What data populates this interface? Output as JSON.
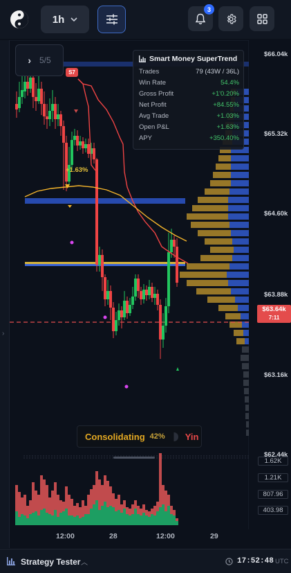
{
  "header": {
    "timeframe": "1h",
    "notification_count": "3",
    "icons": [
      "yin-yang-logo-icon",
      "chevron-down-icon",
      "sliders-icon",
      "bell-icon",
      "gear-icon",
      "grid-icon"
    ]
  },
  "pager": {
    "label": "5/5"
  },
  "stats_panel": {
    "title": "Smart Money SuperTrend",
    "rows": [
      {
        "label": "Trades",
        "value": "79 (43W / 36L)"
      },
      {
        "label": "Win Rate",
        "value": "54.4%"
      },
      {
        "label": "Gross Profit",
        "value": "+1'0.20%"
      },
      {
        "label": "Net Profit",
        "value": "+84.55%"
      },
      {
        "label": "Avg Trade",
        "value": "+1.03%"
      },
      {
        "label": "Open P&L",
        "value": "+1.63%"
      },
      {
        "label": "APY",
        "value": "+350.40%"
      }
    ]
  },
  "chart_data": {
    "type": "candlestick",
    "price_ticks": [
      "$66.04k",
      "$65.32k",
      "$64.60k",
      "$63.88k",
      "$63.16k",
      "$62.44k"
    ],
    "current_price": "$63.64k",
    "countdown": "7:11",
    "volume_ticks": [
      "1.62K",
      "1.21K",
      "807.96",
      "403.98"
    ],
    "time_ticks": [
      "12:00",
      "28",
      "12:00",
      "29"
    ],
    "signal_label": "S7",
    "open_pnl_label": "+1.63%",
    "colors": {
      "up": "#22c55e",
      "down": "#ef4444",
      "supertrend": "#ef4444",
      "ma": "#f5b52b",
      "band": "#2d4fa8"
    }
  },
  "regime": {
    "state": "Consolidating",
    "percent": "42%",
    "bias": "Yin"
  },
  "footer": {
    "panel_label": "Strategy Tester",
    "clock": "17:52:48",
    "timezone": "UTC"
  }
}
